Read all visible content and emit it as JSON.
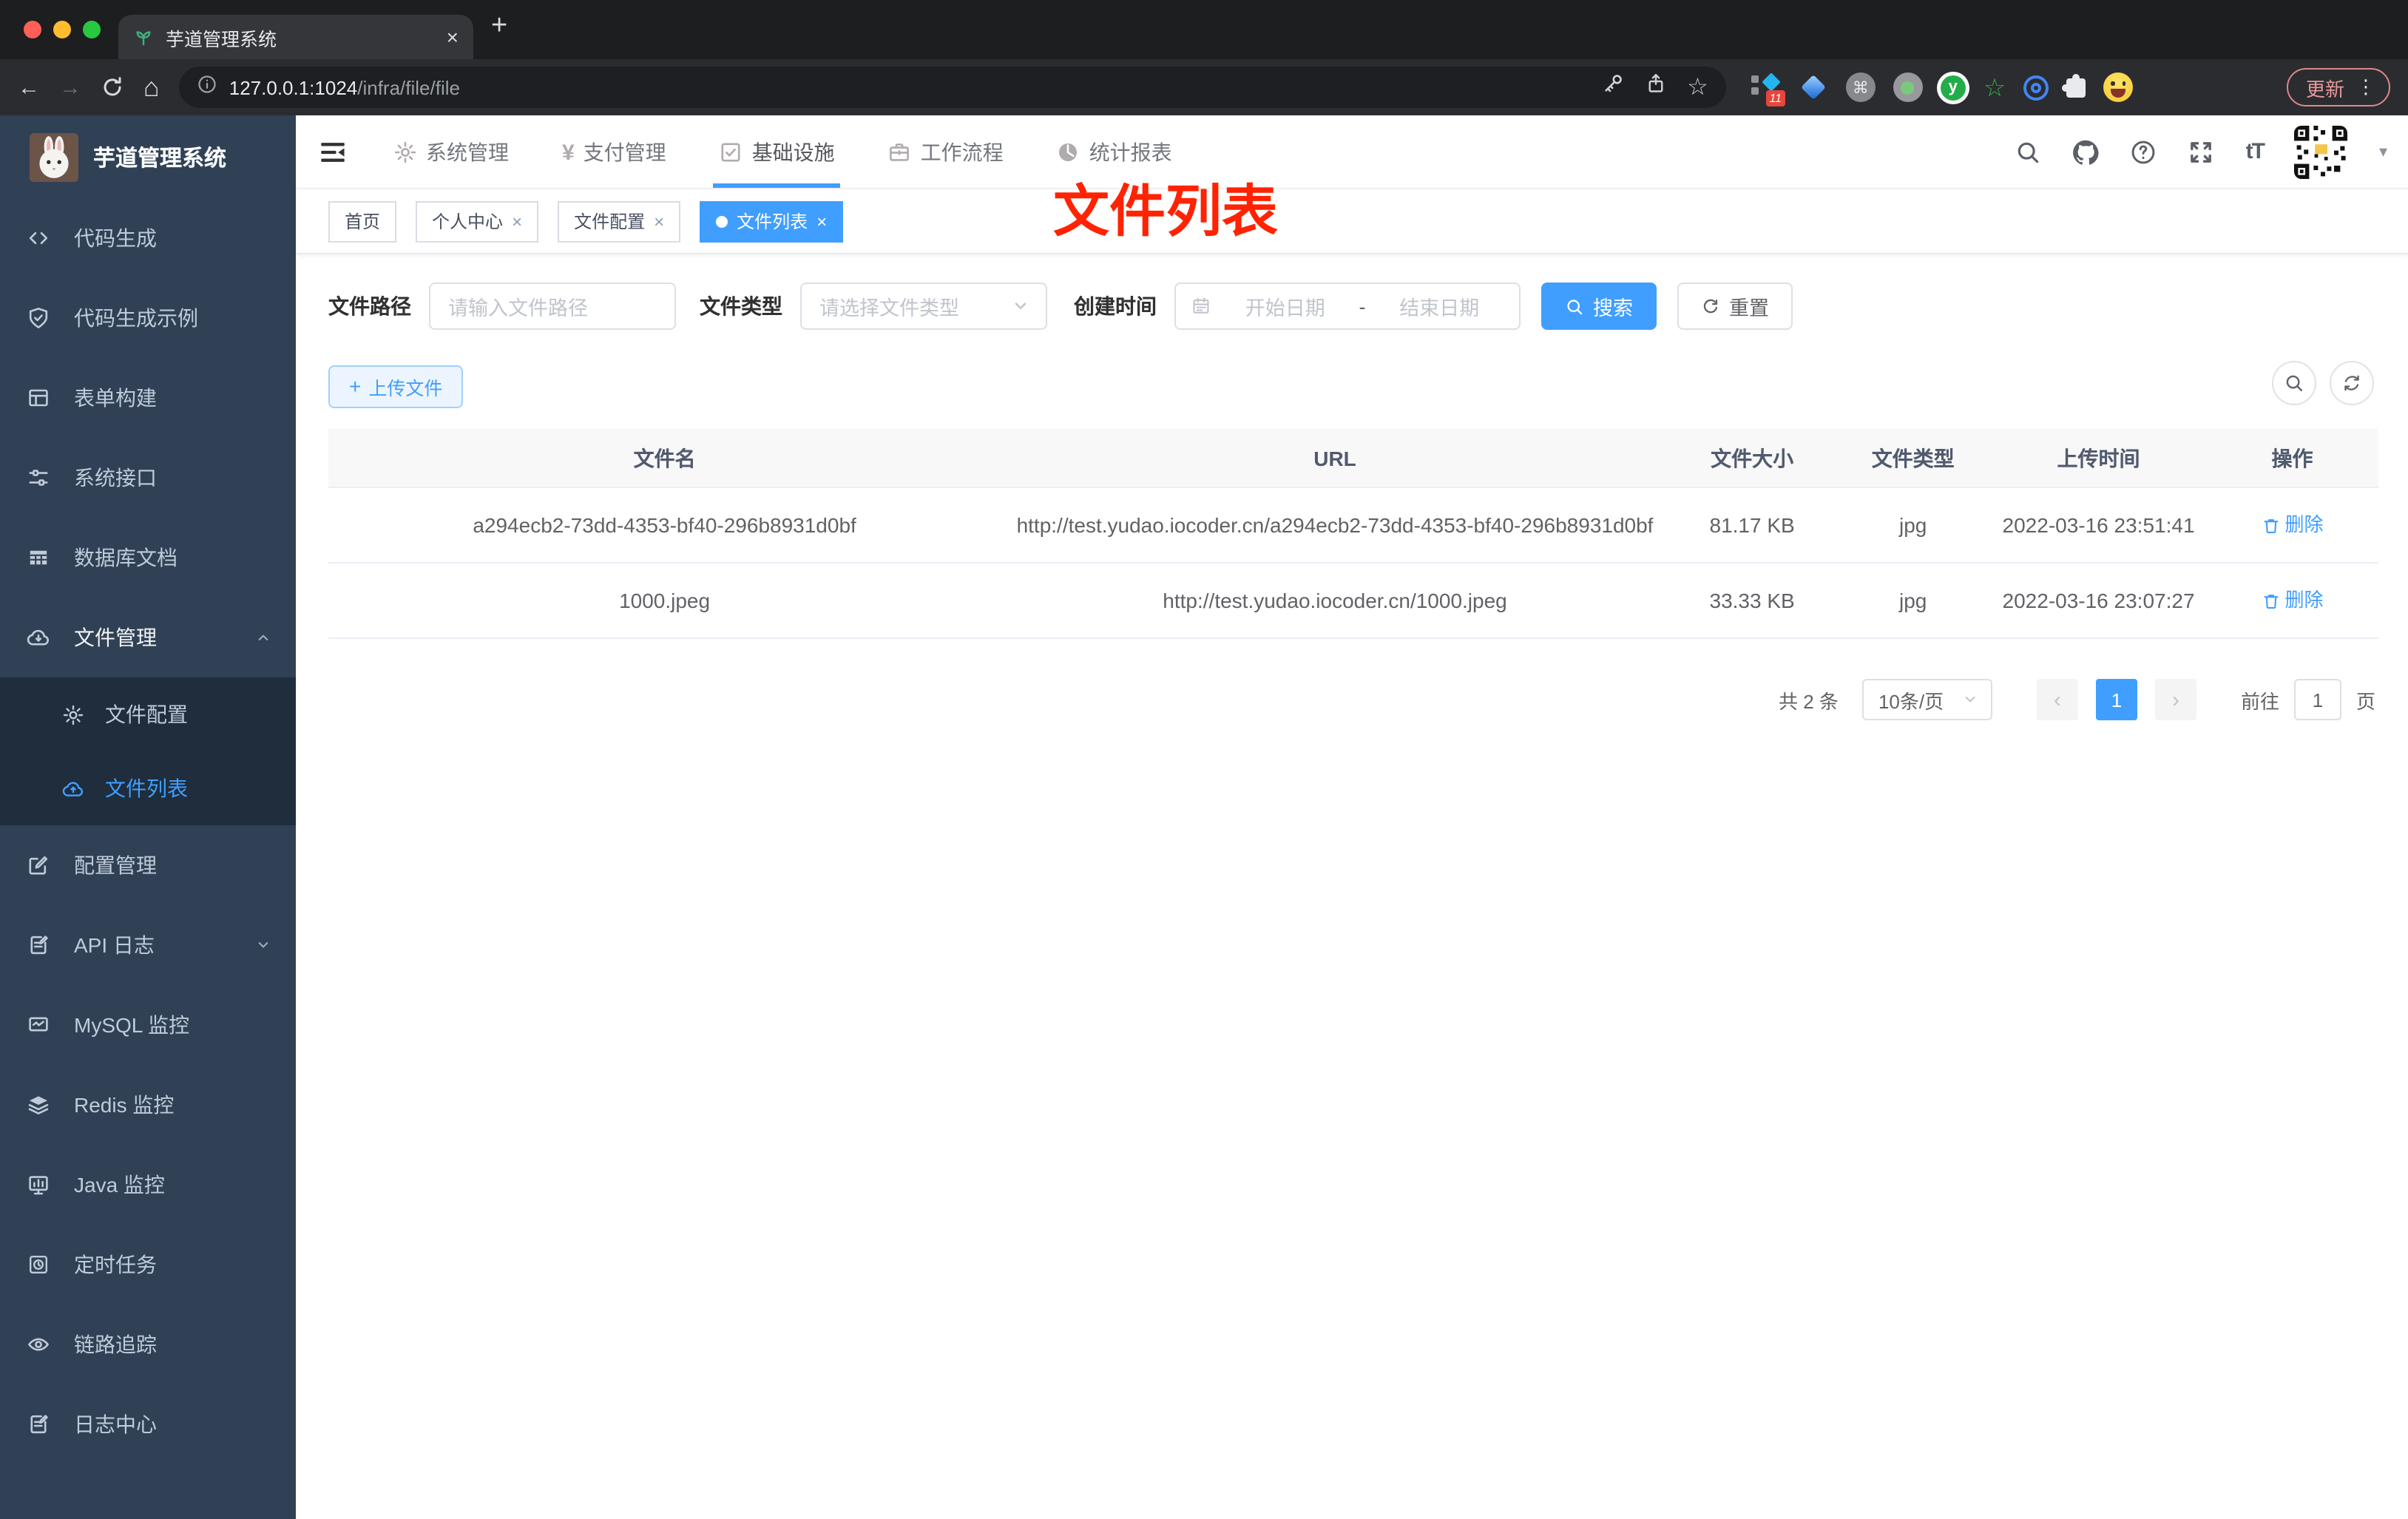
{
  "browser": {
    "tab": {
      "title": "芋道管理系统"
    },
    "url_host": "127.0.0.1:1024",
    "url_path": "/infra/file/file",
    "extensions_badge": "11",
    "update_label": "更新"
  },
  "icons": {
    "close": "×",
    "plus": "+",
    "back": "←",
    "forward": "→",
    "home": "⌂",
    "star": "☆",
    "command": "⌘",
    "menu_dots": "⋮",
    "caret_down": "▾",
    "prev": "‹",
    "next": "›",
    "yen": "¥",
    "font_size": "tT",
    "green_star": "☆",
    "y_letter": "y"
  },
  "sidebar": {
    "title": "芋道管理系统",
    "items": [
      {
        "label": "代码生成"
      },
      {
        "label": "代码生成示例"
      },
      {
        "label": "表单构建"
      },
      {
        "label": "系统接口"
      },
      {
        "label": "数据库文档"
      },
      {
        "label": "文件管理"
      },
      {
        "label": "配置管理"
      },
      {
        "label": "API 日志"
      },
      {
        "label": "MySQL 监控"
      },
      {
        "label": "Redis 监控"
      },
      {
        "label": "Java 监控"
      },
      {
        "label": "定时任务"
      },
      {
        "label": "链路追踪"
      },
      {
        "label": "日志中心"
      }
    ],
    "submenu": [
      {
        "label": "文件配置"
      },
      {
        "label": "文件列表"
      }
    ]
  },
  "navbar": {
    "items": [
      "系统管理",
      "支付管理",
      "基础设施",
      "工作流程",
      "统计报表"
    ],
    "font_button": "tT"
  },
  "tabsbar": {
    "tabs": [
      "首页",
      "个人中心",
      "文件配置",
      "文件列表"
    ]
  },
  "annotation": {
    "text": "文件列表"
  },
  "filters": {
    "path_label": "文件路径",
    "path_placeholder": "请输入文件路径",
    "type_label": "文件类型",
    "type_placeholder": "请选择文件类型",
    "date_label": "创建时间",
    "date_start": "开始日期",
    "date_separator": "-",
    "date_end": "结束日期",
    "search": "搜索",
    "reset": "重置"
  },
  "actions": {
    "upload": "上传文件"
  },
  "table": {
    "columns": [
      "文件名",
      "URL",
      "文件大小",
      "文件类型",
      "上传时间",
      "操作"
    ],
    "rows": [
      {
        "name": "a294ecb2-73dd-4353-bf40-296b8931d0bf",
        "url": "http://test.yudao.iocoder.cn/a294ecb2-73dd-4353-bf40-296b8931d0bf",
        "size": "81.17 KB",
        "type": "jpg",
        "time": "2022-03-16 23:51:41",
        "action": "删除"
      },
      {
        "name": "1000.jpeg",
        "url": "http://test.yudao.iocoder.cn/1000.jpeg",
        "size": "33.33 KB",
        "type": "jpg",
        "time": "2022-03-16 23:07:27",
        "action": "删除"
      }
    ]
  },
  "pagination": {
    "total": "共 2 条",
    "page_size": "10条/页",
    "page": "1",
    "goto_label": "前往",
    "goto_value": "1",
    "unit": "页"
  },
  "colors": {
    "accent": "#409eff",
    "sidebar_bg": "#304156",
    "submenu_bg": "#1f2d3d",
    "annotation_red": "#ff2303"
  }
}
